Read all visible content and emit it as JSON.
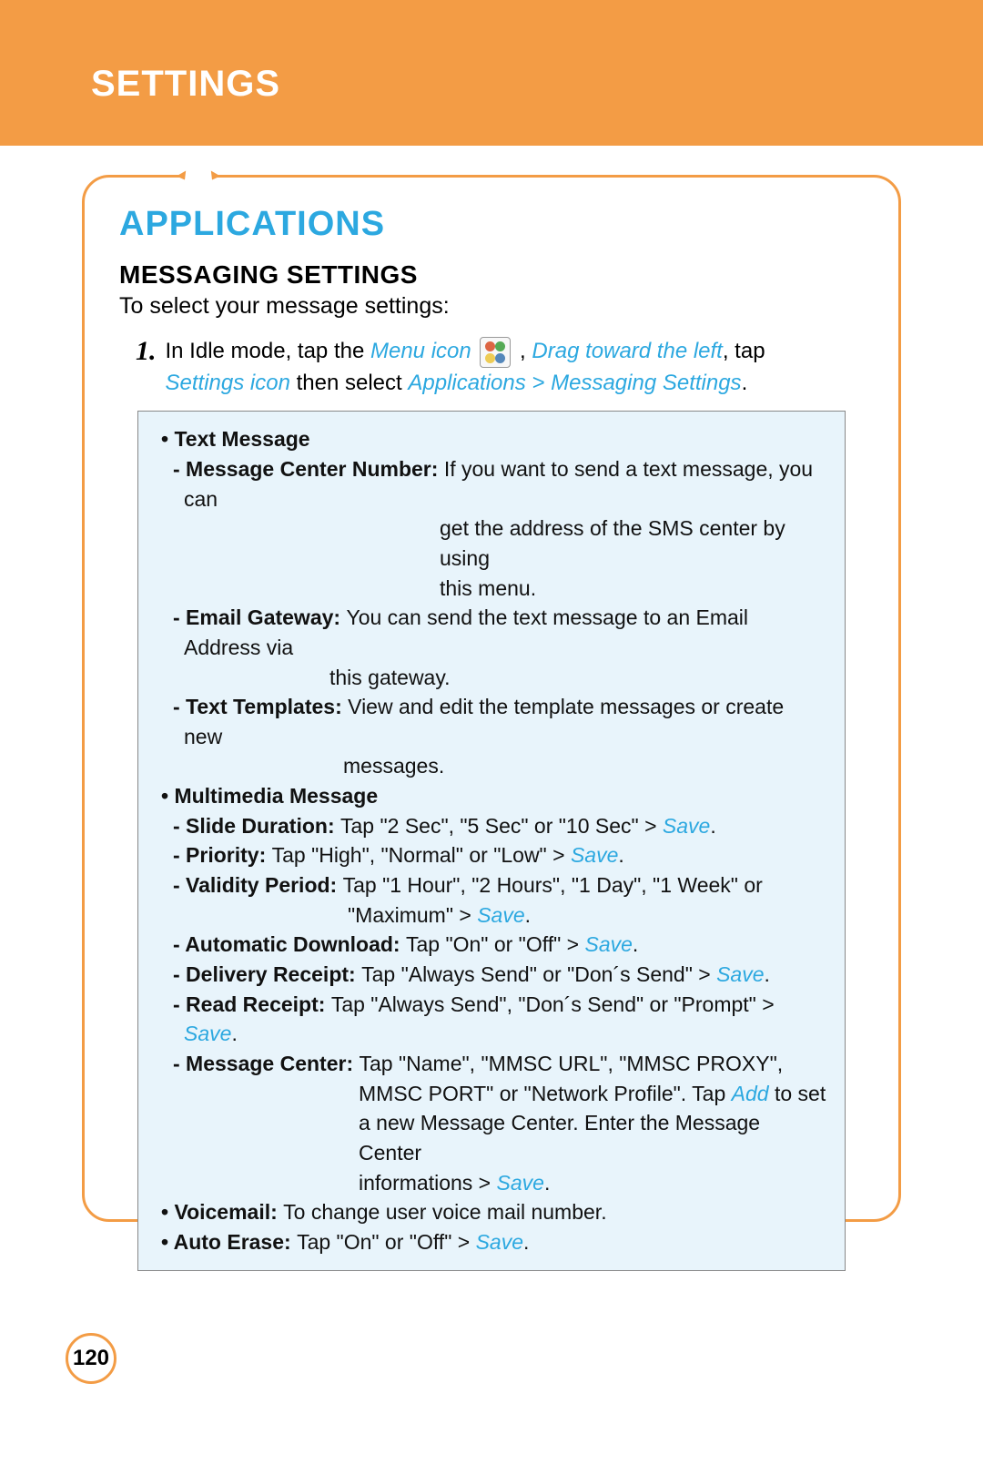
{
  "header": {
    "title": "SETTINGS"
  },
  "page_number": "120",
  "section": {
    "title": "APPLICATIONS",
    "subtitle": "MESSAGING SETTINGS",
    "intro": "To select your message settings:",
    "step_num": "1.",
    "step": {
      "pre": "In Idle mode, tap the ",
      "menu_icon": "Menu icon",
      "mid1": " , ",
      "drag": "Drag toward the left",
      "mid2": ", tap ",
      "settings_icon": "Settings icon",
      "then": " then select ",
      "path": "Applications > Messaging Settings",
      "end": "."
    }
  },
  "box": {
    "text_msg_header": "• Text Message",
    "mcn_label": "- Message Center Number: ",
    "mcn_text1": "If you want to send a text message, you can",
    "mcn_text2": "get the address of the SMS center by using",
    "mcn_text3": "this menu.",
    "eg_label": "- Email Gateway: ",
    "eg_text1": "You can send the text message to an Email Address via",
    "eg_text2": "this gateway.",
    "tt_label": "- Text Templates: ",
    "tt_text1": "View and edit the template messages or create new",
    "tt_text2": "messages.",
    "mm_header": "• Multimedia Message",
    "sd_label": "- Slide Duration: ",
    "sd_text": "Tap \"2 Sec\", \"5 Sec\" or \"10 Sec\" > ",
    "pr_label": "- Priority: ",
    "pr_text": "Tap \"High\", \"Normal\" or \"Low\" > ",
    "vp_label": "- Validity Period: ",
    "vp_text1": "Tap \"1 Hour\", \"2 Hours\", \"1 Day\", \"1 Week\" or",
    "vp_text2": "\"Maximum\" > ",
    "ad_label": "- Automatic Download: ",
    "ad_text": "Tap \"On\" or \"Off\" > ",
    "dr_label": "- Delivery Receipt: ",
    "dr_text": "Tap \"Always Send\" or \"Don´s Send\" > ",
    "rr_label": "- Read Receipt: ",
    "rr_text": "Tap \"Always Send\", \"Don´s Send\" or \"Prompt\" > ",
    "mc_label": "- Message Center: ",
    "mc_text1": "Tap \"Name\", \"MMSC URL\", \"MMSC PROXY\",",
    "mc_text2": "MMSC PORT\" or \"Network Profile\". Tap ",
    "mc_add": "Add",
    "mc_text2b": " to set",
    "mc_text3": "a new Message Center. Enter the Message Center",
    "mc_text4": "informations > ",
    "vm_label": "• Voicemail: ",
    "vm_text": "To change user voice mail number.",
    "ae_label": "• Auto Erase: ",
    "ae_text": "Tap \"On\" or \"Off\" > ",
    "save": "Save",
    "dot": "."
  }
}
